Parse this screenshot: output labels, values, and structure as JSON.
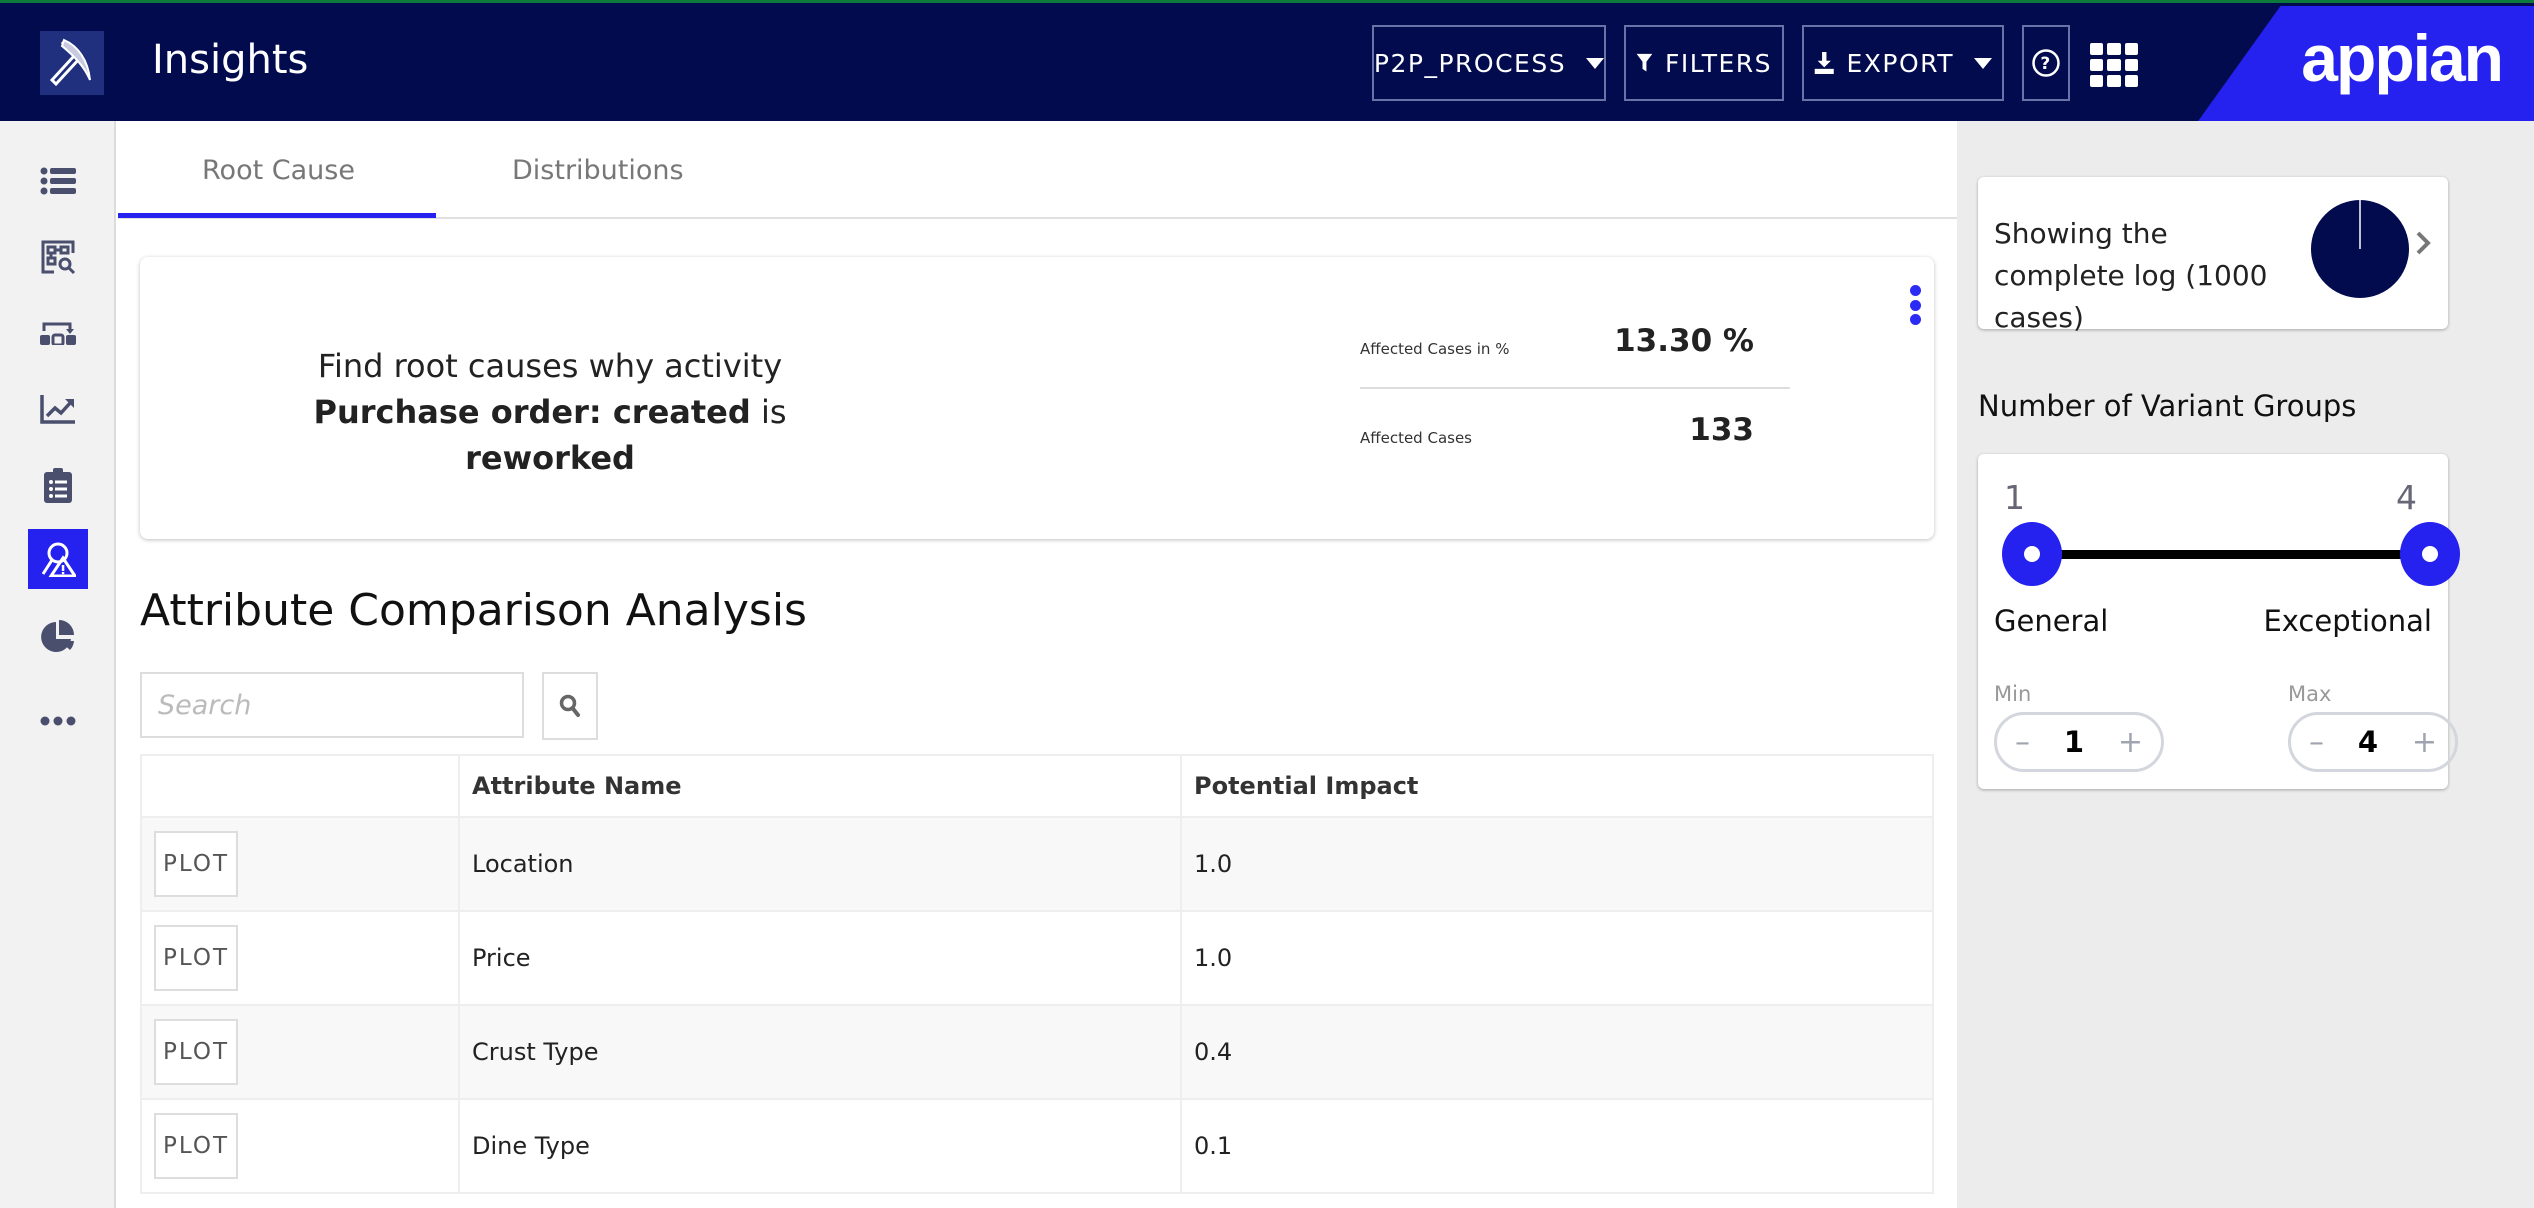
{
  "header": {
    "app_title": "Insights",
    "process_selector": "P2P_PROCESS",
    "filters_label": "FILTERS",
    "export_label": "EXPORT",
    "brand": "appian",
    "colors": {
      "header_bg": "#020b4d",
      "accent": "#2522f0"
    }
  },
  "sidebar": {
    "items": [
      {
        "icon": "list-icon",
        "active": false
      },
      {
        "icon": "process-discovery-icon",
        "active": false
      },
      {
        "icon": "transition-icon",
        "active": false
      },
      {
        "icon": "trend-chart-icon",
        "active": false
      },
      {
        "icon": "clipboard-list-icon",
        "active": false
      },
      {
        "icon": "root-cause-icon",
        "active": true
      },
      {
        "icon": "pie-chart-icon",
        "active": false
      },
      {
        "icon": "more-icon",
        "active": false
      }
    ]
  },
  "tabs": [
    {
      "label": "Root Cause",
      "active": true
    },
    {
      "label": "Distributions",
      "active": false
    }
  ],
  "summary_card": {
    "text_prefix": "Find root causes why activity ",
    "activity": "Purchase order: created",
    "text_middle": " is ",
    "condition": "reworked",
    "metrics": [
      {
        "label": "Affected Cases in %",
        "value": "13.30 %"
      },
      {
        "label": "Affected Cases",
        "value": "133"
      }
    ]
  },
  "analysis": {
    "title": "Attribute Comparison Analysis",
    "search_placeholder": "Search",
    "search_value": "",
    "columns": [
      "",
      "Attribute Name",
      "Potential Impact"
    ],
    "rows": [
      {
        "action": "PLOT",
        "attribute": "Location",
        "impact": "1.0"
      },
      {
        "action": "PLOT",
        "attribute": "Price",
        "impact": "1.0"
      },
      {
        "action": "PLOT",
        "attribute": "Crust Type",
        "impact": "0.4"
      },
      {
        "action": "PLOT",
        "attribute": "Dine Type",
        "impact": "0.1"
      }
    ]
  },
  "right_panel": {
    "log_text": "Showing the complete log (1000 cases)",
    "log_fraction": 1.0,
    "variant_groups_title": "Number of Variant Groups",
    "slider": {
      "min_value": "1",
      "max_value": "4",
      "left_label": "General",
      "right_label": "Exceptional"
    },
    "min_label": "Min",
    "max_label": "Max",
    "min_stepper": "1",
    "max_stepper": "4",
    "minus": "–",
    "plus": "+"
  }
}
